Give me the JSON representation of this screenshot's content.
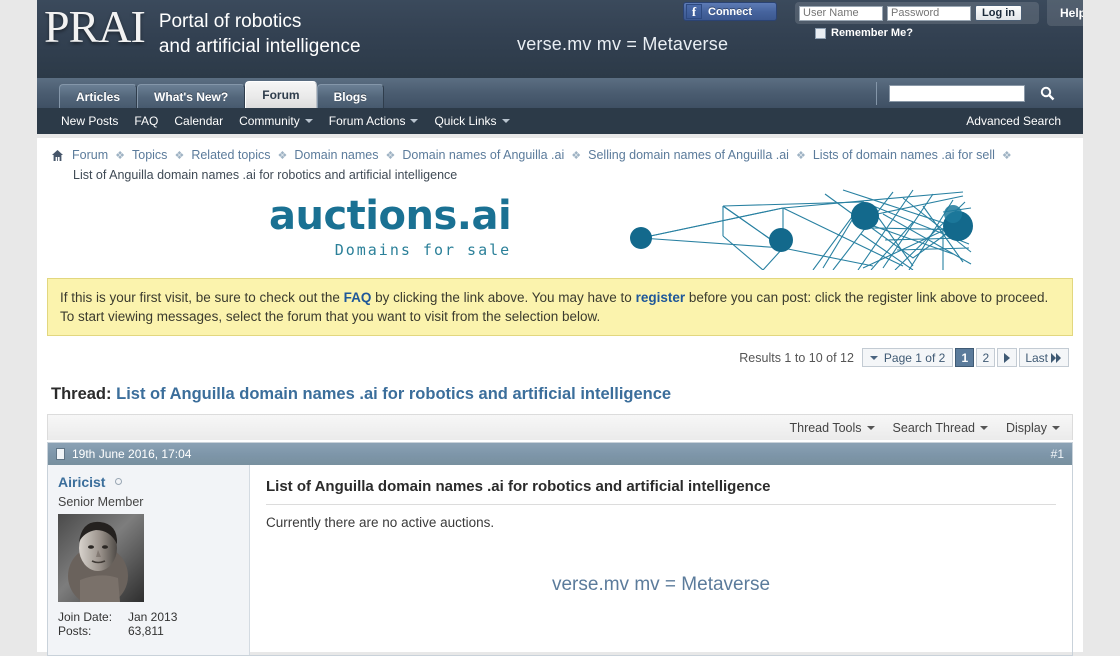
{
  "header": {
    "logo_text": "PRAI",
    "logo_sub_line1": "Portal of robotics",
    "logo_sub_line2": "and artificial intelligence",
    "tagline": "verse.mv mv = Metaverse",
    "facebook_connect_label": "Connect",
    "facebook_icon": "facebook-f-icon",
    "username_placeholder": "User Name",
    "password_placeholder": "Password",
    "login_label": "Log in",
    "remember_label": "Remember Me?",
    "help_label": "Help"
  },
  "nav": {
    "tabs": [
      {
        "label": "Articles",
        "active": false
      },
      {
        "label": "What's New?",
        "active": false
      },
      {
        "label": "Forum",
        "active": true
      },
      {
        "label": "Blogs",
        "active": false
      }
    ],
    "search_value": "",
    "search_placeholder": "",
    "search_icon": "search-icon",
    "subnav": [
      {
        "label": "New Posts",
        "caret": false
      },
      {
        "label": "FAQ",
        "caret": false
      },
      {
        "label": "Calendar",
        "caret": false
      },
      {
        "label": "Community",
        "caret": true
      },
      {
        "label": "Forum Actions",
        "caret": true
      },
      {
        "label": "Quick Links",
        "caret": true
      }
    ],
    "advanced_search_label": "Advanced Search"
  },
  "breadcrumb": {
    "home_icon": "home-icon",
    "items": [
      "Forum",
      "Topics",
      "Related topics",
      "Domain names",
      "Domain names of Anguilla .ai",
      "Selling domain names of Anguilla .ai",
      "Lists of domain names .ai for sell"
    ],
    "current": "List of Anguilla domain names .ai for robotics and artificial intelligence"
  },
  "banner": {
    "title": "auctions.ai",
    "subtitle": "Domains for sale",
    "accent_color": "#1a7193",
    "graphic": "network-graph-illustration"
  },
  "notice": {
    "part1": "If this is your first visit, be sure to check out the ",
    "link1": "FAQ",
    "part2": " by clicking the link above. You may have to ",
    "link2": "register",
    "part3": " before you can post: click the register link above to proceed. To start viewing messages, select the forum that you want to visit from the selection below."
  },
  "pagination": {
    "results_text": "Results 1 to 10 of 12",
    "page_jump_label": "Page 1 of 2",
    "pages": [
      "1",
      "2"
    ],
    "current_page": "1",
    "next_label": "▶",
    "last_label": "Last",
    "last_icon": "double-arrow-right-icon"
  },
  "thread": {
    "prefix": "Thread:",
    "title": "List of Anguilla domain names .ai for robotics and artificial intelligence",
    "tools": [
      {
        "label": "Thread Tools",
        "caret": true
      },
      {
        "label": "Search Thread",
        "caret": true
      },
      {
        "label": "Display",
        "caret": true
      }
    ]
  },
  "post": {
    "date": "19th June 2016, 17:04",
    "number": "#1",
    "page_icon": "post-page-icon",
    "user": {
      "name": "Airicist",
      "status_icon": "offline-status-icon",
      "title": "Senior Member",
      "avatar": "user-avatar-photo",
      "join_date_label": "Join Date:",
      "join_date_value": "Jan 2013",
      "posts_label": "Posts:",
      "posts_value": "63,811"
    },
    "content_title": "List of Anguilla domain names .ai for robotics and artificial intelligence",
    "body_text": "Currently there are no active auctions.",
    "signature": "verse.mv mv = Metaverse"
  },
  "colors": {
    "header_dark": "#334152",
    "nav_mid": "#4b5d71",
    "subnav": "#2c3a48",
    "page_bg": "#e8e8e8",
    "notice_bg": "#fbf3ad",
    "link": "#3b6e9b",
    "teal": "#1a7193",
    "post_head": "#7e96aa"
  }
}
